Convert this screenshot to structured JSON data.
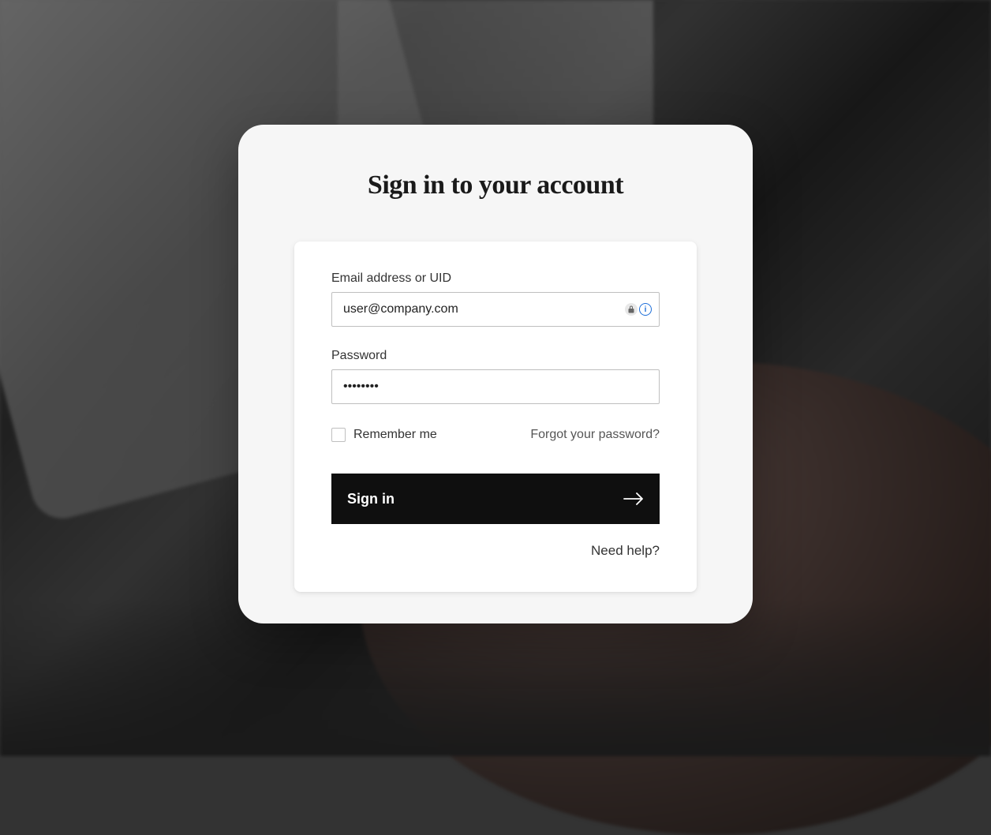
{
  "card": {
    "title": "Sign in to your account"
  },
  "form": {
    "email": {
      "label": "Email address or UID",
      "value": "user@company.com"
    },
    "password": {
      "label": "Password",
      "value": "••••••••"
    },
    "remember": {
      "label": "Remember me"
    },
    "forgot": {
      "label": "Forgot your password?"
    },
    "submit": {
      "label": "Sign in"
    },
    "help": {
      "label": "Need help?"
    }
  }
}
